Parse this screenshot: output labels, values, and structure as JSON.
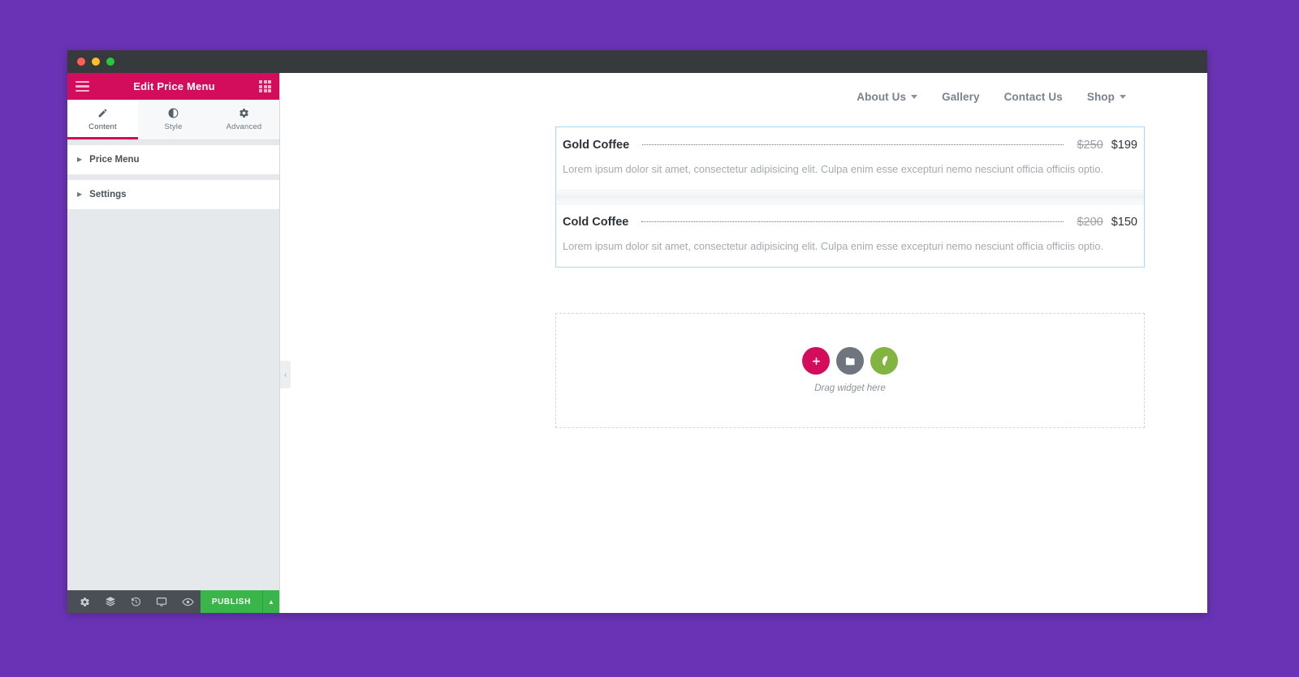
{
  "window": {
    "traffic_lights": [
      "red",
      "yellow",
      "green"
    ]
  },
  "editor_panel": {
    "header": {
      "menu_icon": "hamburger-icon",
      "title": "Edit Price Menu",
      "grid_icon": "grid-icon"
    },
    "tabs": [
      {
        "label": "Content",
        "icon": "pencil-icon",
        "active": true
      },
      {
        "label": "Style",
        "icon": "contrast-circle-icon",
        "active": false
      },
      {
        "label": "Advanced",
        "icon": "gear-icon",
        "active": false
      }
    ],
    "sections": [
      {
        "label": "Price Menu",
        "expanded": false
      },
      {
        "label": "Settings",
        "expanded": false
      }
    ],
    "footer": {
      "icons": [
        "settings-gear-icon",
        "layers-icon",
        "history-revisions-icon",
        "responsive-mode-icon",
        "preview-eye-icon"
      ],
      "publish_label": "PUBLISH",
      "publish_arrow_icon": "chevron-up-icon"
    }
  },
  "canvas": {
    "collapse_handle_icon": "chevron-left-icon",
    "site_nav": [
      {
        "label": "About Us",
        "has_dropdown": true
      },
      {
        "label": "Gallery",
        "has_dropdown": false
      },
      {
        "label": "Contact Us",
        "has_dropdown": false
      },
      {
        "label": "Shop",
        "has_dropdown": true
      }
    ],
    "price_menu": {
      "selected": true,
      "items": [
        {
          "title": "Gold Coffee",
          "old_price": "$250",
          "price": "$199",
          "description": "Lorem ipsum dolor sit amet, consectetur adipisicing elit. Culpa enim esse excepturi nemo nesciunt officia officiis optio."
        },
        {
          "title": "Cold Coffee",
          "old_price": "$200",
          "price": "$150",
          "description": "Lorem ipsum dolor sit amet, consectetur adipisicing elit. Culpa enim esse excepturi nemo nesciunt officia officiis optio."
        }
      ]
    },
    "drop_zone": {
      "label": "Drag widget here",
      "buttons": [
        {
          "name": "add-element-button",
          "icon": "plus-icon",
          "color": "#d30c5c"
        },
        {
          "name": "add-template-button",
          "icon": "folder-icon",
          "color": "#6e757c"
        },
        {
          "name": "envato-kit-button",
          "icon": "leaf-icon",
          "color": "#81b441"
        }
      ]
    }
  },
  "colors": {
    "brand_pink": "#d30c5c",
    "publish_green": "#39b54a",
    "page_background": "#6a33b5",
    "selection_border": "#a8dcf0"
  }
}
